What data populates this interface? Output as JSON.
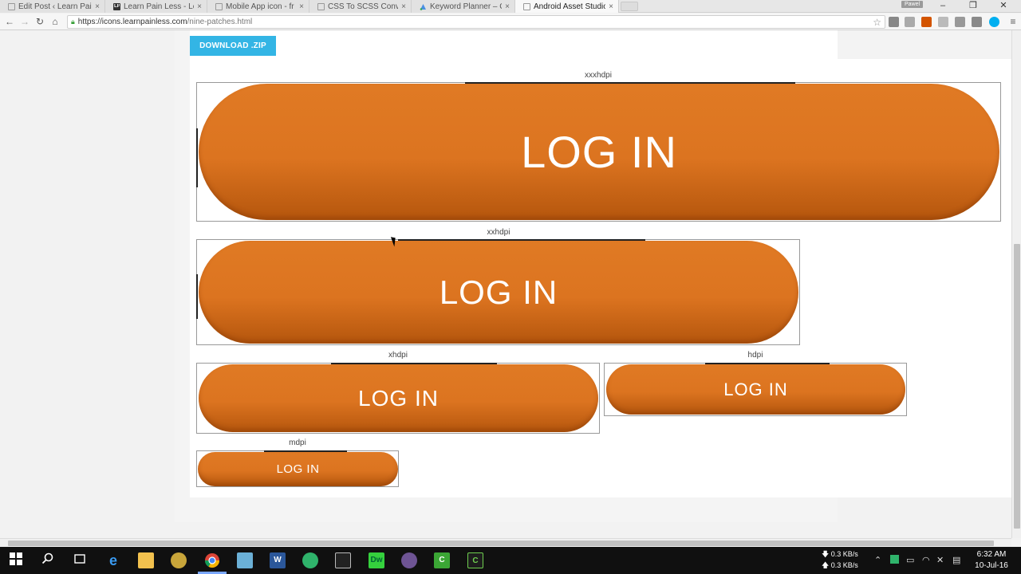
{
  "browser": {
    "tabs": [
      {
        "title": "Edit Post ‹ Learn Pain",
        "favicon": "page-icon",
        "active": false
      },
      {
        "title": "Learn Pain Less - Lea",
        "favicon": "lpl-logo-icon",
        "favicon_text": "LPL",
        "active": false
      },
      {
        "title": "Mobile App icon - fr",
        "favicon": "page-icon",
        "active": false
      },
      {
        "title": "CSS To SCSS Conver",
        "favicon": "page-icon",
        "active": false
      },
      {
        "title": "Keyword Planner – G",
        "favicon": "adwords-icon",
        "active": false
      },
      {
        "title": "Android Asset Studio",
        "favicon": "page-icon",
        "active": true
      }
    ],
    "close_glyph": "×",
    "user_badge": "Pawel",
    "window_controls": {
      "minimize": "–",
      "restore": "❐",
      "close": "✕"
    },
    "nav": {
      "back": "←",
      "forward": "→",
      "reload": "↻",
      "home": "⌂"
    },
    "url_host": "https://icons.learnpainless.com",
    "url_path": "/nine-patches.html",
    "bookmark_glyph": "☆",
    "menu_glyph": "≡"
  },
  "page": {
    "download_label": "DOWNLOAD .ZIP",
    "densities": [
      {
        "label": "xxxhdpi",
        "button_text": "LOG IN"
      },
      {
        "label": "xxhdpi",
        "button_text": "LOG IN"
      },
      {
        "label": "xhdpi",
        "button_text": "LOG IN"
      },
      {
        "label": "hdpi",
        "button_text": "LOG IN"
      },
      {
        "label": "mdpi",
        "button_text": "LOG IN"
      }
    ],
    "button_color": "#e07a24"
  },
  "taskbar": {
    "apps": [
      "start",
      "search",
      "task-view",
      "edge",
      "file-explorer",
      "media",
      "chrome",
      "notepad",
      "word",
      "app-green",
      "cmd",
      "dreamweaver",
      "github",
      "camtasia",
      "camtasia-recorder"
    ],
    "net_down": "0.3 KB/s",
    "net_up": "0.3 KB/s",
    "time": "6:32 AM",
    "date": "10-Jul-16"
  }
}
